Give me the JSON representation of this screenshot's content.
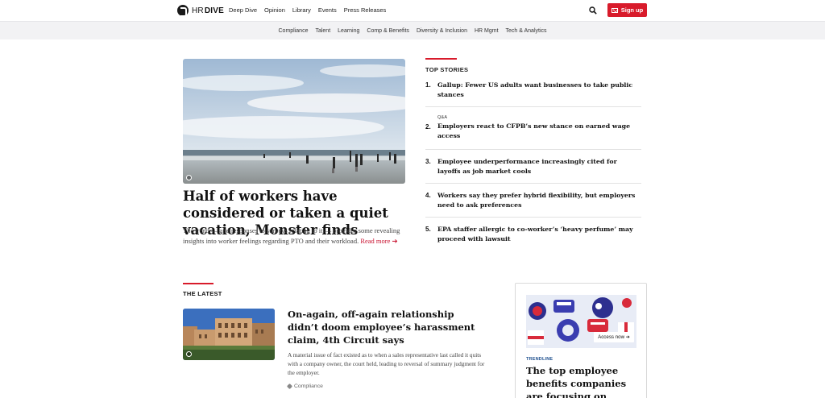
{
  "header": {
    "logo_hr": "HR",
    "logo_dive": "DIVE",
    "nav": [
      "Deep Dive",
      "Opinion",
      "Library",
      "Events",
      "Press Releases"
    ],
    "signup_label": "Sign up"
  },
  "subnav": [
    "Compliance",
    "Talent",
    "Learning",
    "Comp & Benefits",
    "Diversity & Inclusion",
    "HR Mgmt",
    "Tech & Analytics"
  ],
  "hero": {
    "title": "Half of workers have considered or taken a quiet vacation, Monster finds",
    "description": "The trend — and responses to surveys relating to it — provides some revealing insights into worker feelings regarding PTO and their workload.",
    "read_more": "Read more ➔"
  },
  "top_stories": {
    "heading": "TOP STORIES",
    "items": [
      {
        "num": "1.",
        "kicker": "",
        "title": "Gallup: Fewer US adults want businesses to take public stances"
      },
      {
        "num": "2.",
        "kicker": "Q&A",
        "title": "Employers react to CFPB’s new stance on earned wage access"
      },
      {
        "num": "3.",
        "kicker": "",
        "title": "Employee underperformance increasingly cited for layoffs as job market cools"
      },
      {
        "num": "4.",
        "kicker": "",
        "title": "Workers say they prefer hybrid flexibility, but employers need to ask preferences"
      },
      {
        "num": "5.",
        "kicker": "",
        "title": "EPA staffer allergic to co-worker’s ‘heavy perfume’ may proceed with lawsuit"
      }
    ]
  },
  "latest": {
    "heading": "THE LATEST",
    "title": "On-again, off-again relationship didn’t doom employee’s harassment claim, 4th Circuit says",
    "description": "A material issue of fact existed as to when a sales representative last called it quits with a company owner, the court held, leading to reversal of summary judgment for the employer.",
    "tag": "Compliance"
  },
  "trendline": {
    "access_label": "Access now ➔",
    "kicker": "TRENDLINE",
    "title": "The top employee benefits companies are focusing on"
  },
  "colors": {
    "accent": "#d81b2b",
    "trendline_blue": "#1d4f8e"
  }
}
